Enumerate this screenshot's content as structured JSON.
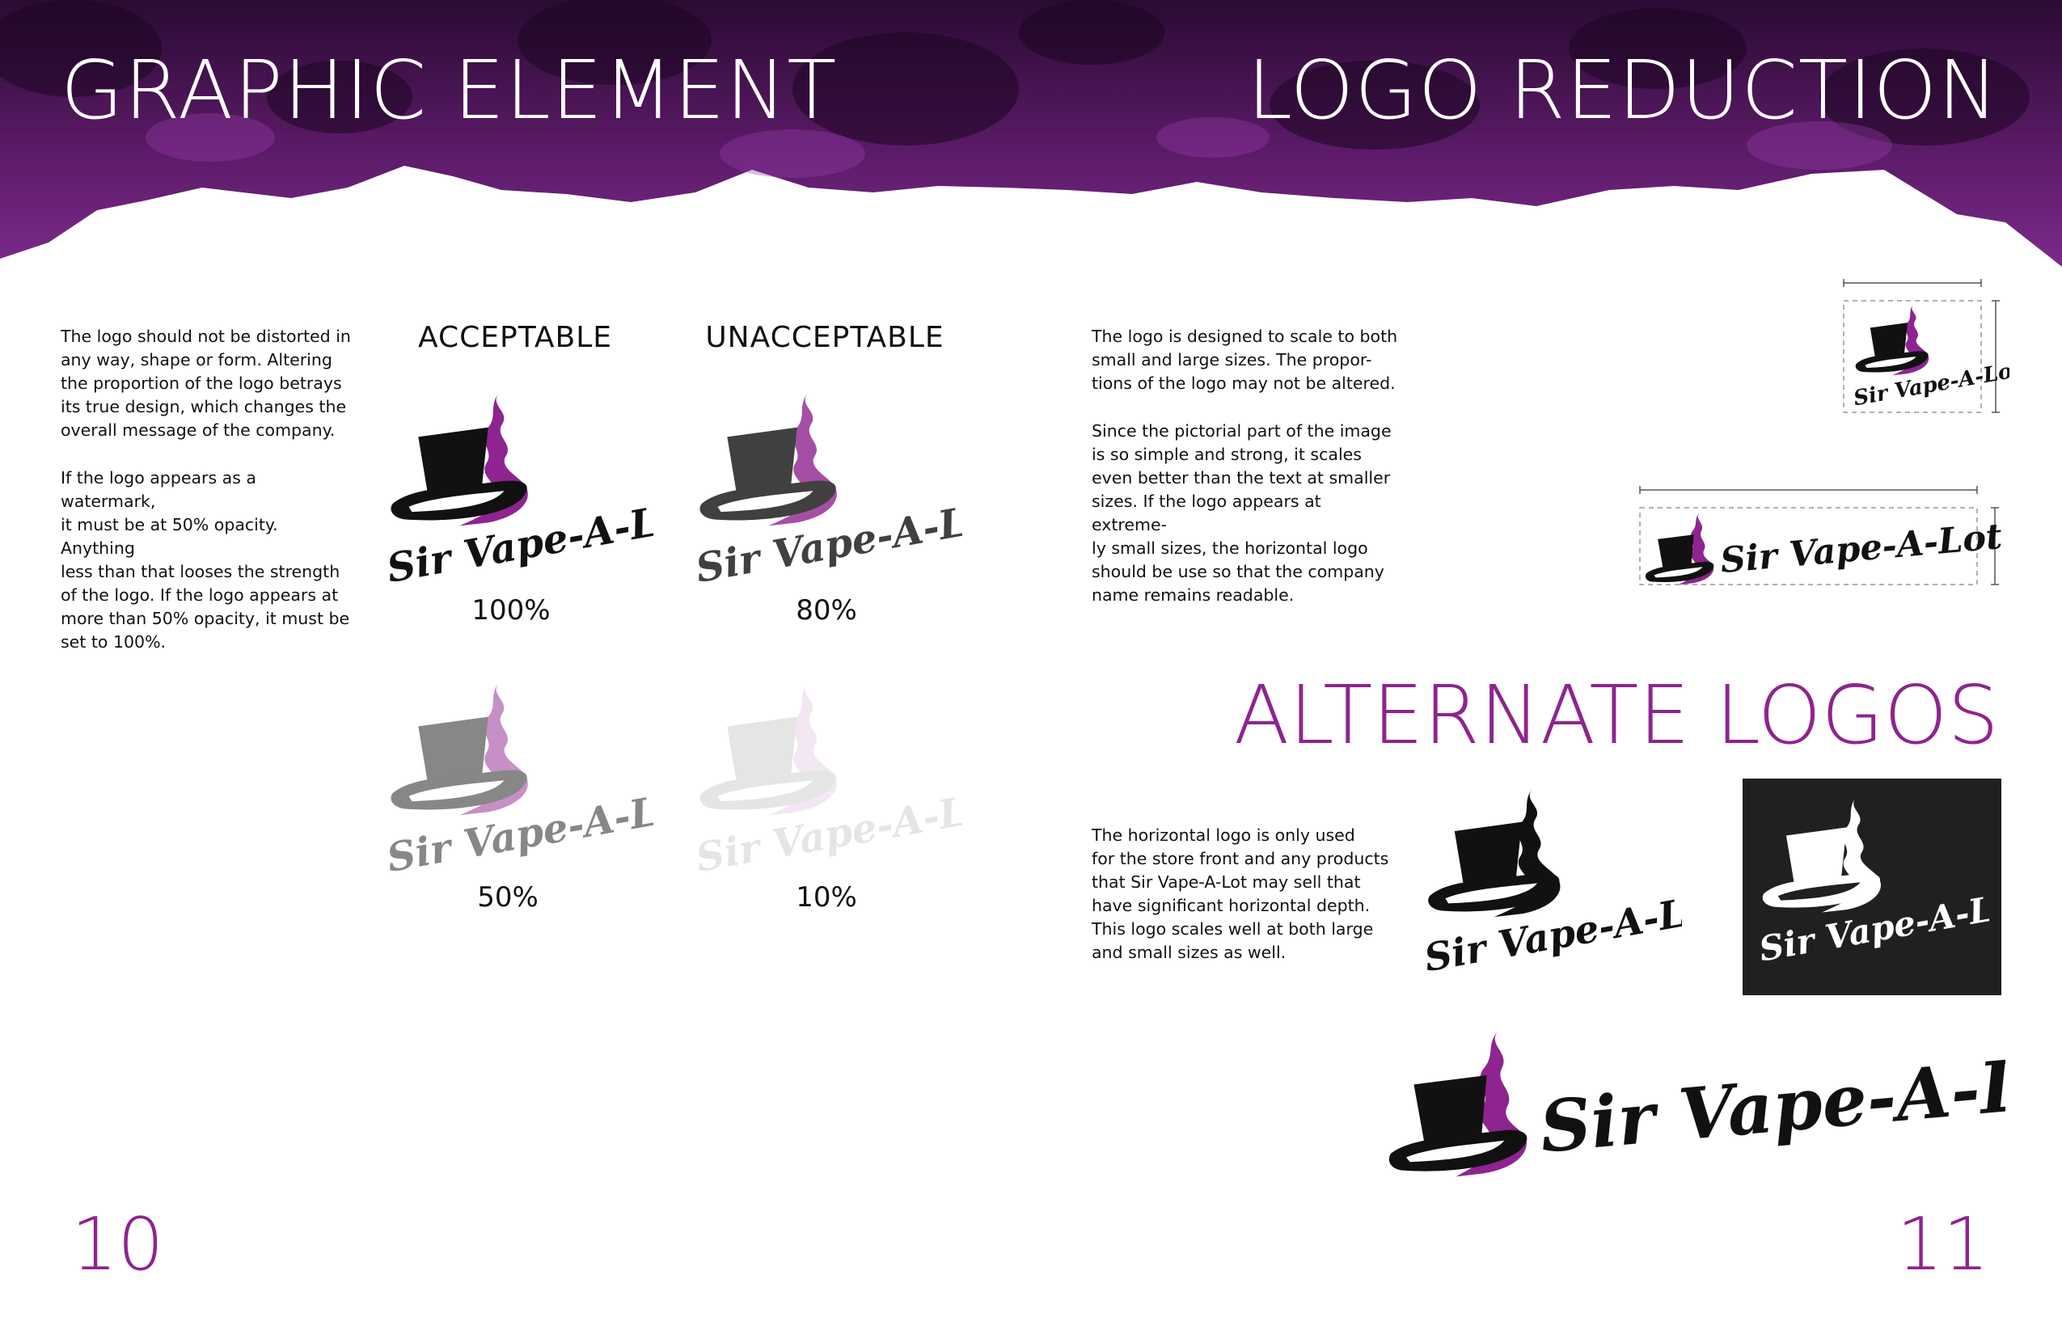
{
  "header": {
    "left_title": "GRAPHIC ELEMENT",
    "right_title": "LOGO REDUCTION",
    "banner_color": "#5a1a66"
  },
  "left_page": {
    "paragraph_1": "The logo should not be distorted in\nany way, shape or form. Altering\nthe proportion of the logo betrays\nits true design, which changes the\noverall message of the company.",
    "paragraph_2": "If the logo appears as a watermark,\nit must be at 50% opacity. Anything\nless than that looses the strength\nof the logo. If the logo appears at\nmore than 50% opacity, it must be\nset to 100%.",
    "acceptable_label": "ACCEPTABLE",
    "unacceptable_label": "UNACCEPTABLE",
    "opacity_examples": [
      {
        "label": "100%",
        "opacity": 1.0
      },
      {
        "label": "80%",
        "opacity": 0.8
      },
      {
        "label": "50%",
        "opacity": 0.5
      },
      {
        "label": "10%",
        "opacity": 0.1
      }
    ],
    "page_number": "10"
  },
  "right_page": {
    "reduction_paragraph_1": "The logo is designed to scale to both\nsmall and large sizes. The propor-\ntions of the logo may not be altered.",
    "reduction_paragraph_2": "Since the pictorial part of the image\nis so simple and strong, it scales\neven better than the text at smaller\nsizes. If the logo appears at extreme-\nly small sizes, the horizontal logo\nshould be use so that the company\nname remains readable.",
    "alternate_title": "ALTERNATE LOGOS",
    "alternate_paragraph": "The horizontal logo is only used\nfor the store front and any products\nthat Sir Vape-A-Lot may sell that\nhave significant horizontal depth.\nThis logo scales well at both large\nand small sizes as well.",
    "page_number": "11"
  },
  "brand": {
    "name": "Sir Vape-A-Lot",
    "primary_color": "#8e248f",
    "dark_color": "#221f20"
  }
}
